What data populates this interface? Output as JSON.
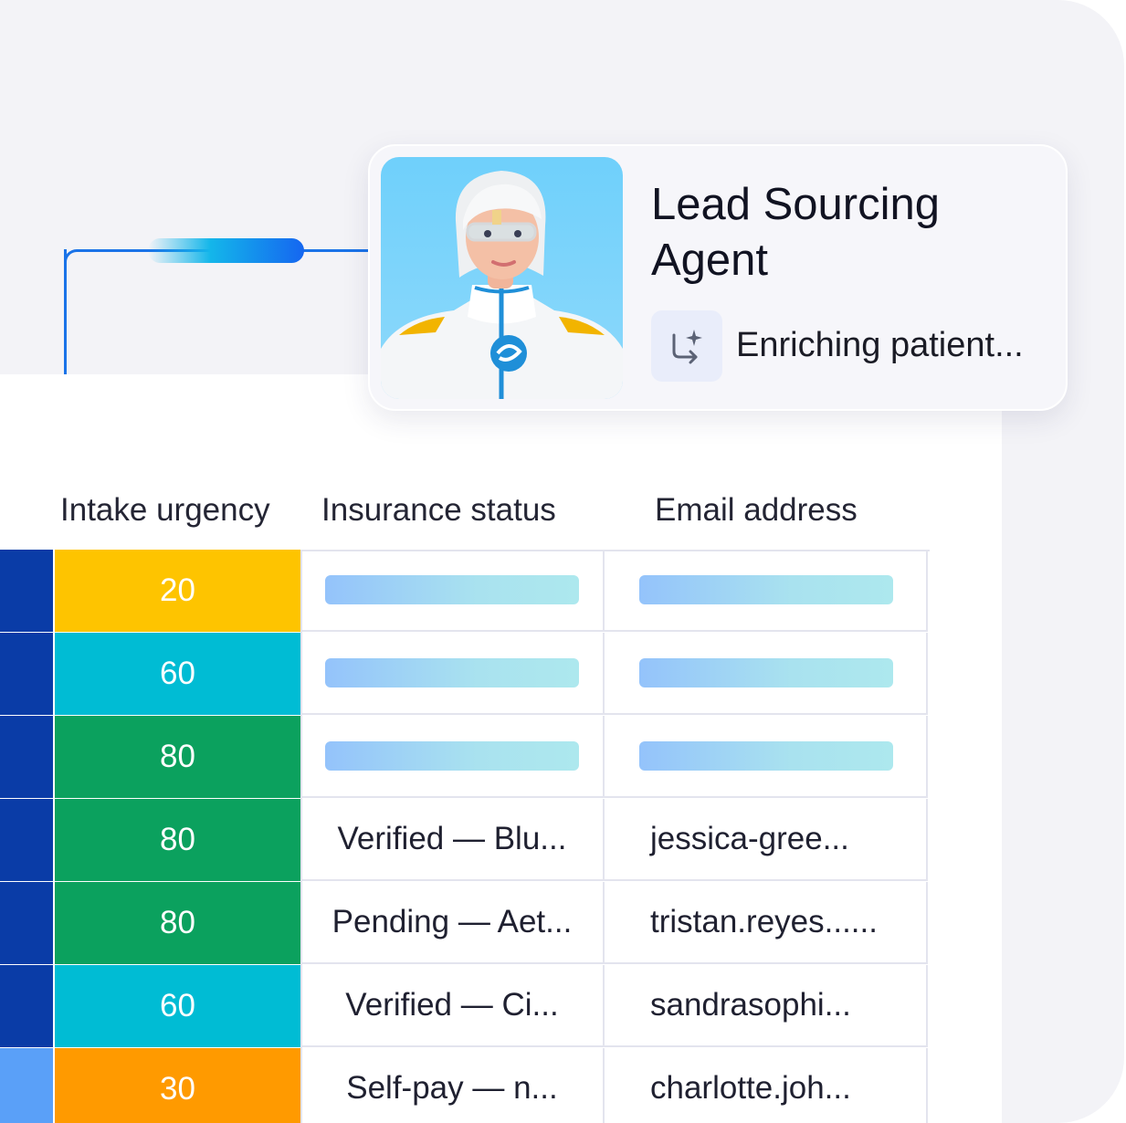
{
  "agent": {
    "title": "Lead Sourcing Agent",
    "status": "Enriching patient...",
    "avatar_icon": "agent-avatar",
    "status_icon": "enrich-sparkle-icon"
  },
  "table": {
    "columns": [
      "Intake urgency",
      "Insurance status",
      "Email address"
    ],
    "rows": [
      {
        "urgency": "20",
        "urgency_color": "#FEC400",
        "strip_color": "#0A3CA7",
        "insurance": "",
        "email": "",
        "loading": true
      },
      {
        "urgency": "60",
        "urgency_color": "#00BCD4",
        "strip_color": "#0A3CA7",
        "insurance": "",
        "email": "",
        "loading": true
      },
      {
        "urgency": "80",
        "urgency_color": "#0BA15E",
        "strip_color": "#0A3CA7",
        "insurance": "",
        "email": "",
        "loading": true
      },
      {
        "urgency": "80",
        "urgency_color": "#0BA15E",
        "strip_color": "#0A3CA7",
        "insurance": "Verified — Blu...",
        "email": "jessica-gree...",
        "loading": false
      },
      {
        "urgency": "80",
        "urgency_color": "#0BA15E",
        "strip_color": "#0A3CA7",
        "insurance": "Pending — Aet...",
        "email": "tristan.reyes......",
        "loading": false
      },
      {
        "urgency": "60",
        "urgency_color": "#00BCD4",
        "strip_color": "#0A3CA7",
        "insurance": "Verified — Ci...",
        "email": "sandrasophi...",
        "loading": false
      },
      {
        "urgency": "30",
        "urgency_color": "#FF9A00",
        "strip_color": "#5AA0F8",
        "insurance": "Self-pay — n...",
        "email": "charlotte.joh...",
        "loading": false
      }
    ]
  },
  "colors": {
    "connector": "#1A73E8",
    "frame_bg": "#F3F3F7"
  }
}
